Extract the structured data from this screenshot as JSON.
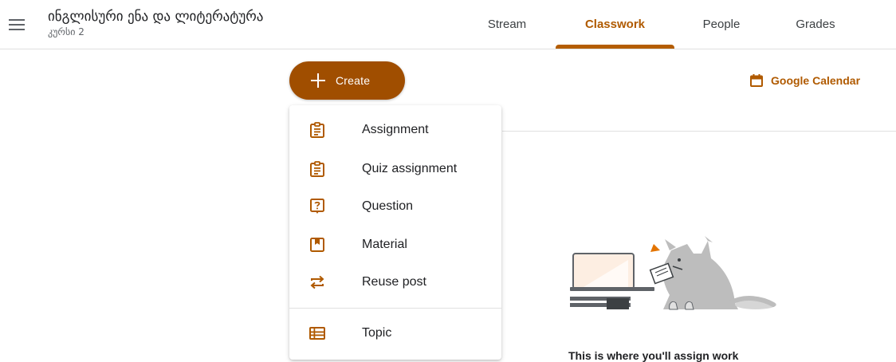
{
  "header": {
    "class_title": "ინგლისური ენა და ლიტერატურა",
    "class_subtitle": "კურსი 2",
    "menu_icon": "hamburger-menu-icon"
  },
  "tabs": [
    {
      "label": "Stream",
      "active": false
    },
    {
      "label": "Classwork",
      "active": true
    },
    {
      "label": "People",
      "active": false
    },
    {
      "label": "Grades",
      "active": false
    }
  ],
  "toolbar": {
    "create_label": "Create",
    "create_icon": "plus-icon",
    "calendar_label": "Google Calendar",
    "calendar_icon": "calendar-icon"
  },
  "create_menu": {
    "items": [
      {
        "label": "Assignment",
        "icon": "assignment-icon"
      },
      {
        "label": "Quiz assignment",
        "icon": "quiz-assignment-icon"
      },
      {
        "label": "Question",
        "icon": "question-icon"
      },
      {
        "label": "Material",
        "icon": "material-icon"
      },
      {
        "label": "Reuse post",
        "icon": "reuse-post-icon"
      },
      {
        "label": "Topic",
        "icon": "topic-icon"
      }
    ]
  },
  "empty_state": {
    "message": "This is where you'll assign work"
  },
  "colors": {
    "accent": "#b05a00",
    "create_button": "#a04e00",
    "text": "#202124",
    "divider": "#e0e0e0"
  }
}
